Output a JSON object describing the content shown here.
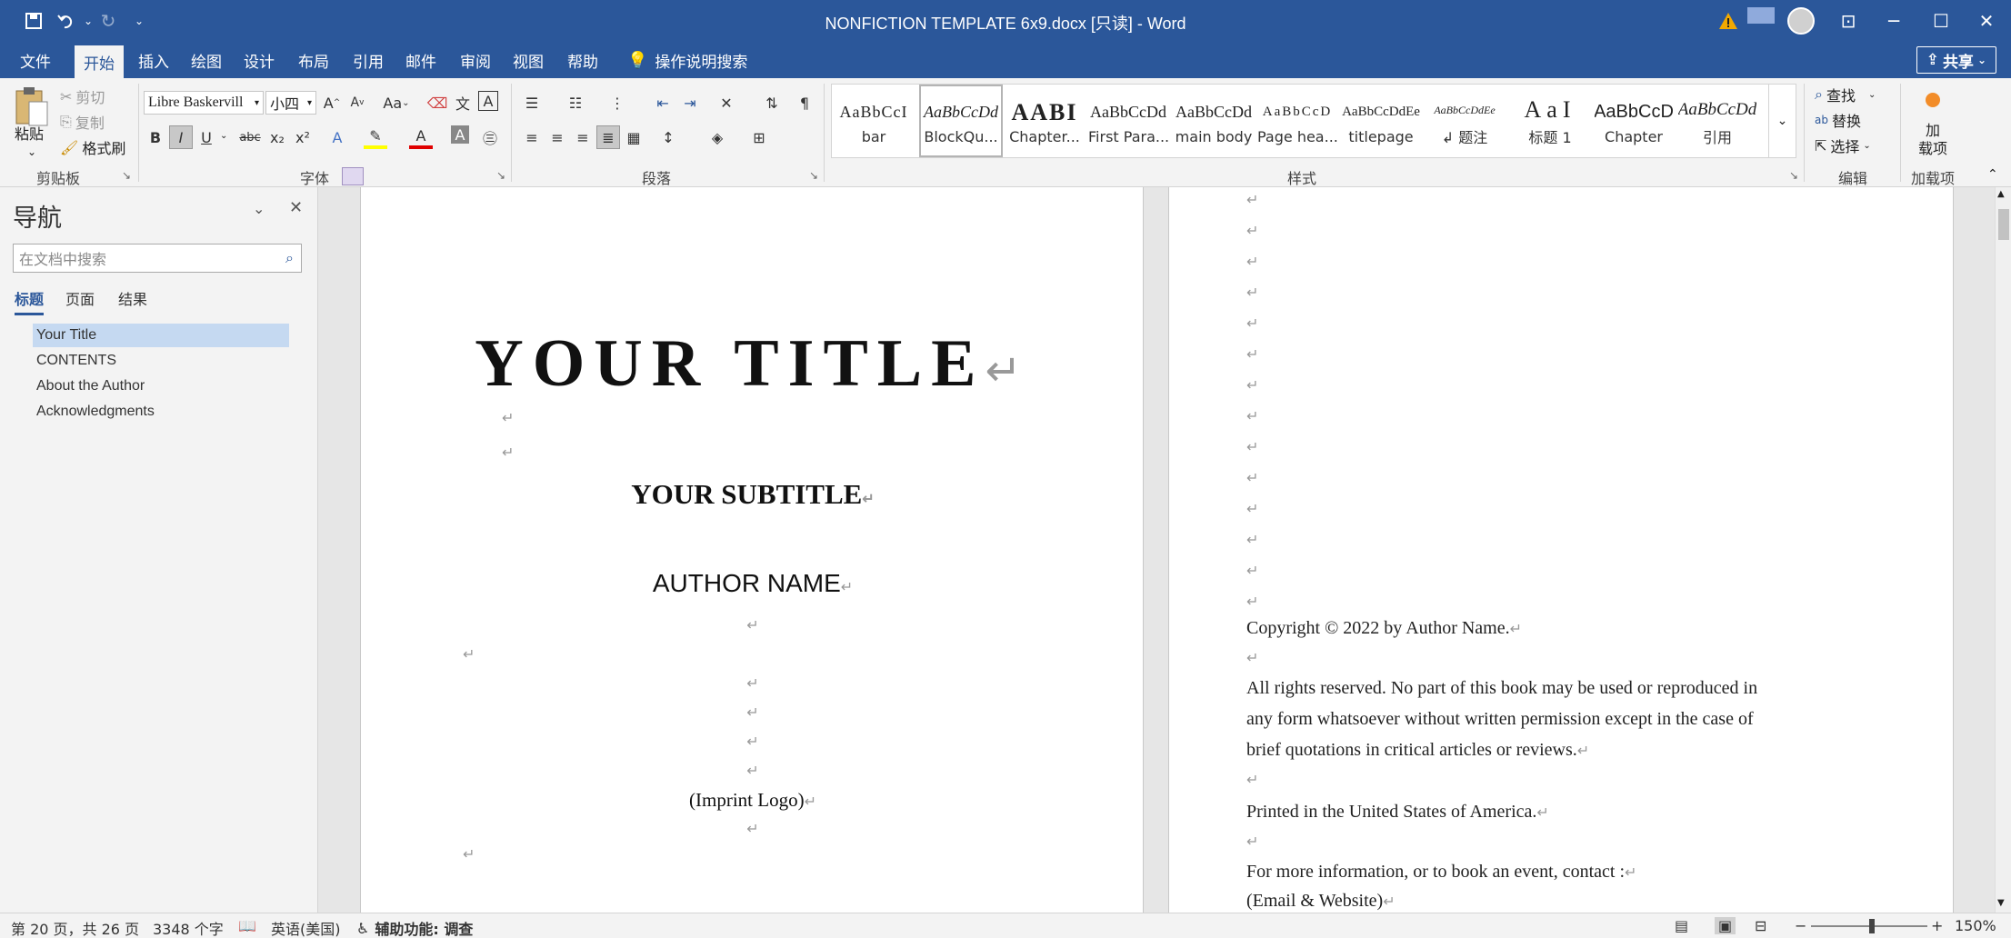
{
  "titlebar": {
    "title": "NONFICTION TEMPLATE 6x9.docx [只读]  -  Word",
    "qa_icons": [
      "save-icon",
      "undo-icon",
      "dropdown-icon",
      "redo-icon",
      "customize-icon"
    ],
    "win_controls": [
      "ribbon-display-icon",
      "minimize-icon",
      "maximize-icon",
      "close-icon"
    ]
  },
  "menu": {
    "tabs": [
      "文件",
      "开始",
      "插入",
      "绘图",
      "设计",
      "布局",
      "引用",
      "邮件",
      "审阅",
      "视图",
      "帮助"
    ],
    "active": "开始",
    "tell_me": "操作说明搜索",
    "share": "共享"
  },
  "ribbon": {
    "clipboard": {
      "paste": "粘贴",
      "cut": "剪切",
      "copy": "复制",
      "format_painter": "格式刷",
      "label": "剪贴板"
    },
    "font": {
      "name": "Libre Baskervill",
      "size": "小四",
      "case": "Aa",
      "label": "字体",
      "buttons": [
        "B",
        "I",
        "U",
        "abc",
        "x₂",
        "x²"
      ]
    },
    "paragraph": {
      "label": "段落"
    },
    "styles": {
      "label": "样式",
      "items": [
        {
          "preview": "AaBbCcI",
          "name": "bar"
        },
        {
          "preview": "AaBbCcDd",
          "name": "BlockQu..."
        },
        {
          "preview": "AABI",
          "name": "Chapter..."
        },
        {
          "preview": "AaBbCcDd",
          "name": "First Para..."
        },
        {
          "preview": "AaBbCcDd",
          "name": "main body"
        },
        {
          "preview": "AaBbCcD",
          "name": "Page hea..."
        },
        {
          "preview": "AaBbCcDdEe",
          "name": "titlepage"
        },
        {
          "preview": "AaBbCcDdEe",
          "name": "↲ 题注"
        },
        {
          "preview": "AaI",
          "name": "标题 1"
        },
        {
          "preview": "AaBbCcD",
          "name": "Chapter"
        },
        {
          "preview": "AaBbCcDd",
          "name": "引用"
        }
      ],
      "selected": 1
    },
    "editing": {
      "find": "查找",
      "replace": "替换",
      "select": "选择",
      "label": "编辑"
    },
    "addins": {
      "name": "加\n载项",
      "label": "加载项"
    }
  },
  "nav": {
    "title": "导航",
    "search_placeholder": "在文档中搜索",
    "tabs": [
      "标题",
      "页面",
      "结果"
    ],
    "headings": [
      "Your Title",
      "CONTENTS",
      "About the Author",
      "Acknowledgments"
    ]
  },
  "page1": {
    "title": "YOUR TITLE",
    "subtitle": "YOUR SUBTITLE",
    "author": "AUTHOR NAME",
    "imprint": "(Imprint Logo)",
    "mark": "↵"
  },
  "page2": {
    "copyright": "Copyright © 2022 by Author Name.",
    "rights_1": "All rights reserved. No part of this book may be used or reproduced in",
    "rights_2": "any form whatsoever without written permission except in the case of",
    "rights_3": "brief quotations in critical articles or reviews.",
    "printed": "Printed in the United States of America.",
    "info": "For more information, or to book an event, contact :",
    "contact": "(Email & Website)"
  },
  "status": {
    "page": "第 20 页，共 26 页",
    "words": "3348 个字",
    "lang": "英语(美国)",
    "access": "辅助功能: 调查",
    "zoom": "150%"
  }
}
